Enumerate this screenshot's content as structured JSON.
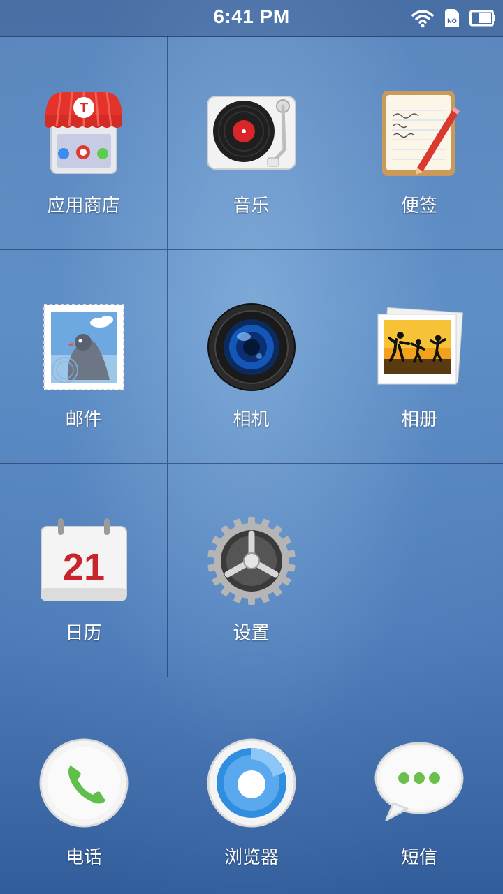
{
  "status_bar": {
    "time": "6:41 PM",
    "sim_label": "NO"
  },
  "apps": [
    {
      "label": "应用商店",
      "icon": "app-store-icon"
    },
    {
      "label": "音乐",
      "icon": "music-turntable-icon"
    },
    {
      "label": "便签",
      "icon": "notes-icon"
    },
    {
      "label": "邮件",
      "icon": "mail-stamp-icon"
    },
    {
      "label": "相机",
      "icon": "camera-lens-icon"
    },
    {
      "label": "相册",
      "icon": "photo-album-icon"
    },
    {
      "label": "日历",
      "icon": "calendar-icon",
      "day": "21"
    },
    {
      "label": "设置",
      "icon": "settings-gear-icon"
    }
  ],
  "dock": [
    {
      "label": "电话",
      "icon": "phone-icon"
    },
    {
      "label": "浏览器",
      "icon": "browser-icon"
    },
    {
      "label": "短信",
      "icon": "messages-icon"
    }
  ]
}
